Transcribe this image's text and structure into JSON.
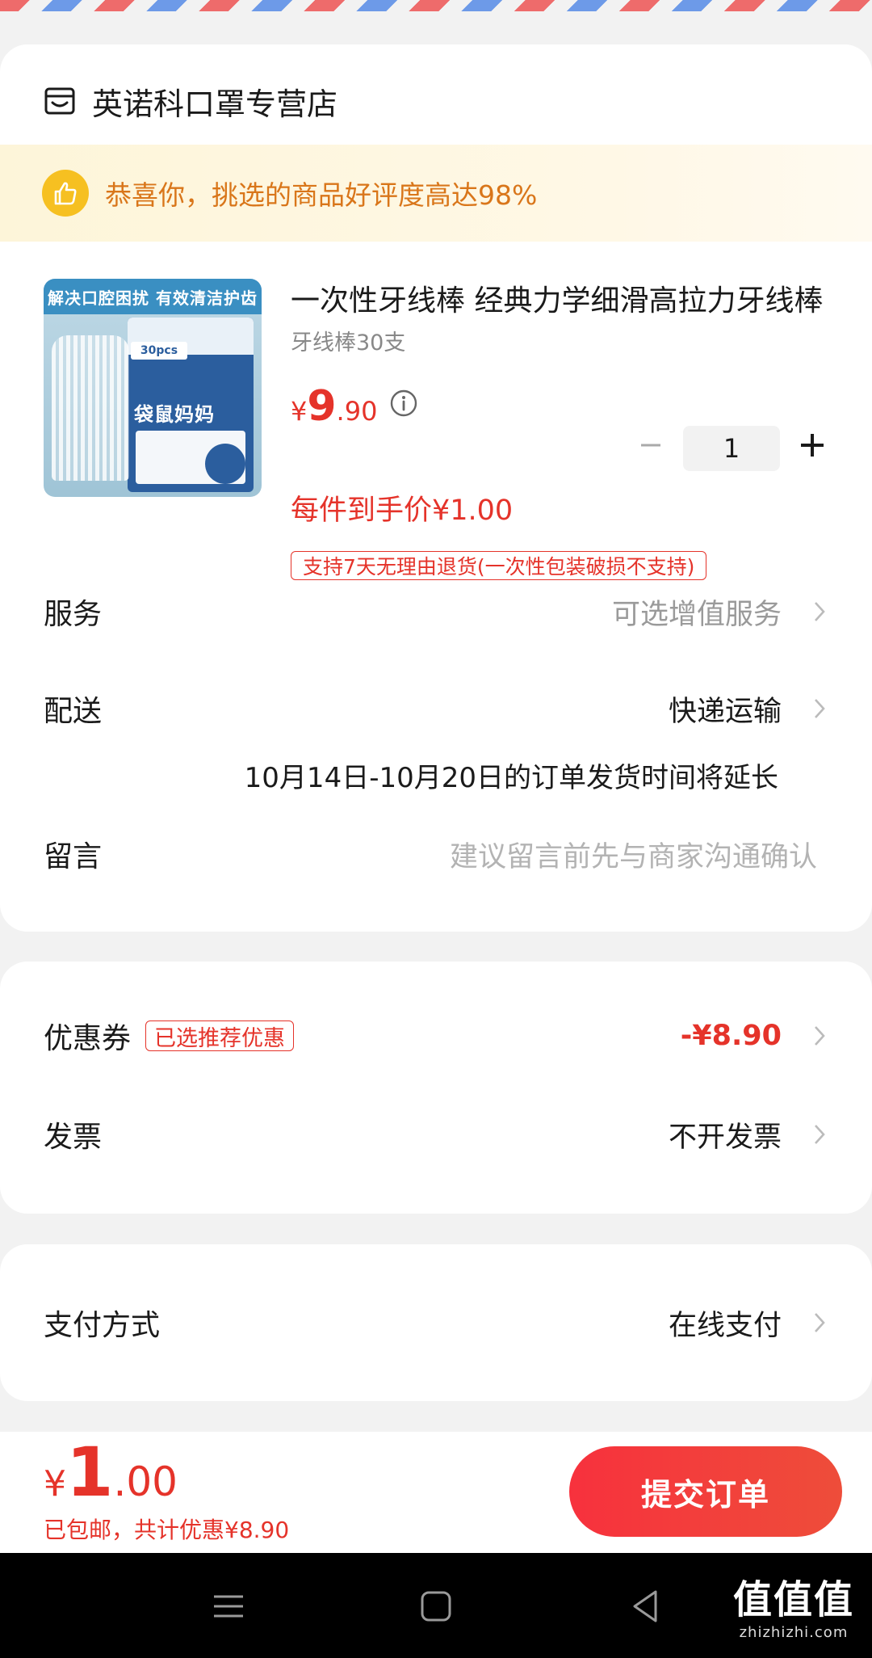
{
  "store": {
    "name": "英诺科口罩专营店"
  },
  "banner": {
    "text": "恭喜你，挑选的商品好评度高达98%"
  },
  "product": {
    "image_banner": "解决口腔困扰 有效清洁护齿",
    "image_brand": "袋鼠妈妈",
    "image_count": "30pcs",
    "title": "一次性牙线棒 经典力学细滑高拉力牙线棒",
    "spec": "牙线棒30支",
    "price": {
      "symbol": "¥",
      "integer": "9",
      "decimal": ".90"
    },
    "quantity": "1",
    "unit_price": "每件到手价¥1.00",
    "return_policy": "支持7天无理由退货(一次性包装破损不支持)"
  },
  "rows": {
    "service": {
      "label": "服务",
      "value": "可选增值服务"
    },
    "delivery": {
      "label": "配送",
      "value": "快递运输",
      "note": "10月14日-10月20日的订单发货时间将延长"
    },
    "message": {
      "label": "留言",
      "placeholder": "建议留言前先与商家沟通确认"
    },
    "coupon": {
      "label": "优惠券",
      "tag": "已选推荐优惠",
      "value": "-¥8.90"
    },
    "invoice": {
      "label": "发票",
      "value": "不开发票"
    },
    "payment": {
      "label": "支付方式",
      "value": "在线支付"
    }
  },
  "footer": {
    "total": {
      "symbol": "¥",
      "integer": "1",
      "decimal": ".00"
    },
    "note": "已包邮，共计优惠¥8.90",
    "submit_label": "提交订单"
  },
  "watermark": {
    "big": "值值值",
    "small": "zhizhizhi.com"
  },
  "colors": {
    "accent": "#e5332a",
    "banner_text": "#d9761a",
    "thumb_badge": "#f6c021"
  }
}
